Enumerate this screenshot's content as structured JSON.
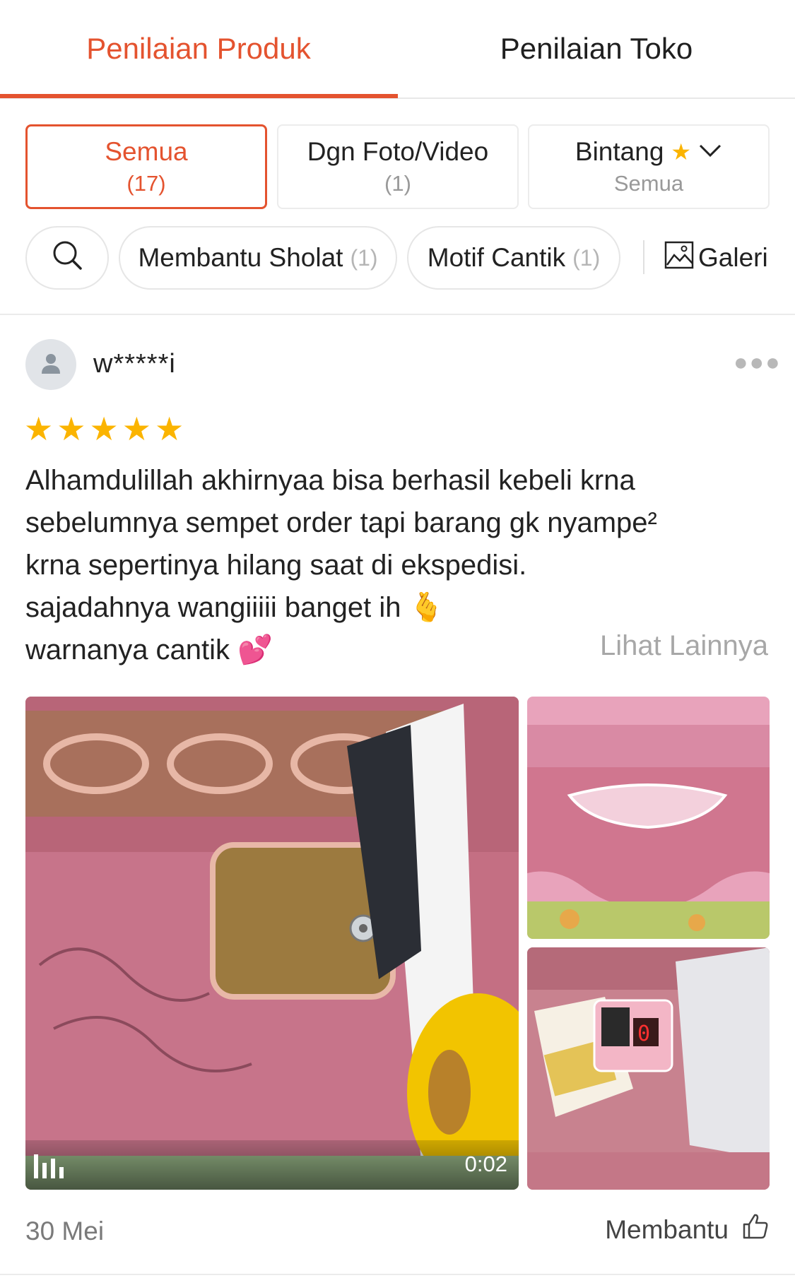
{
  "tabs": {
    "product": "Penilaian Produk",
    "shop": "Penilaian Toko"
  },
  "filters": {
    "all": {
      "label": "Semua",
      "count": "(17)"
    },
    "photo_video": {
      "label": "Dgn Foto/Video",
      "count": "(1)"
    },
    "stars": {
      "label": "Bintang",
      "sub": "Semua"
    }
  },
  "chips": [
    {
      "label": "Membantu Sholat",
      "count": "(1)"
    },
    {
      "label": "Motif Cantik",
      "count": "(1)"
    }
  ],
  "gallery_label": "Galeri",
  "review": {
    "username": "w*****i",
    "rating": 5,
    "lines": [
      "Alhamdulillah akhirnyaa bisa berhasil kebeli krna",
      "sebelumnya sempet order tapi barang gk nyampe²",
      "krna sepertinya hilang saat di ekspedisi.",
      "sajadahnya wangiiiii banget ih 🫰",
      "warnanya cantik 💕"
    ],
    "see_more": "Lihat Lainnya",
    "video_duration": "0:02",
    "date": "30 Mei",
    "helpful": "Membantu"
  },
  "colors": {
    "accent": "#e4532f",
    "star": "#fbb400"
  },
  "icons": [
    "search-icon",
    "star-icon",
    "chevron-down-icon",
    "gallery-icon",
    "user-icon",
    "more-icon",
    "video-icon",
    "thumbs-up-icon"
  ]
}
